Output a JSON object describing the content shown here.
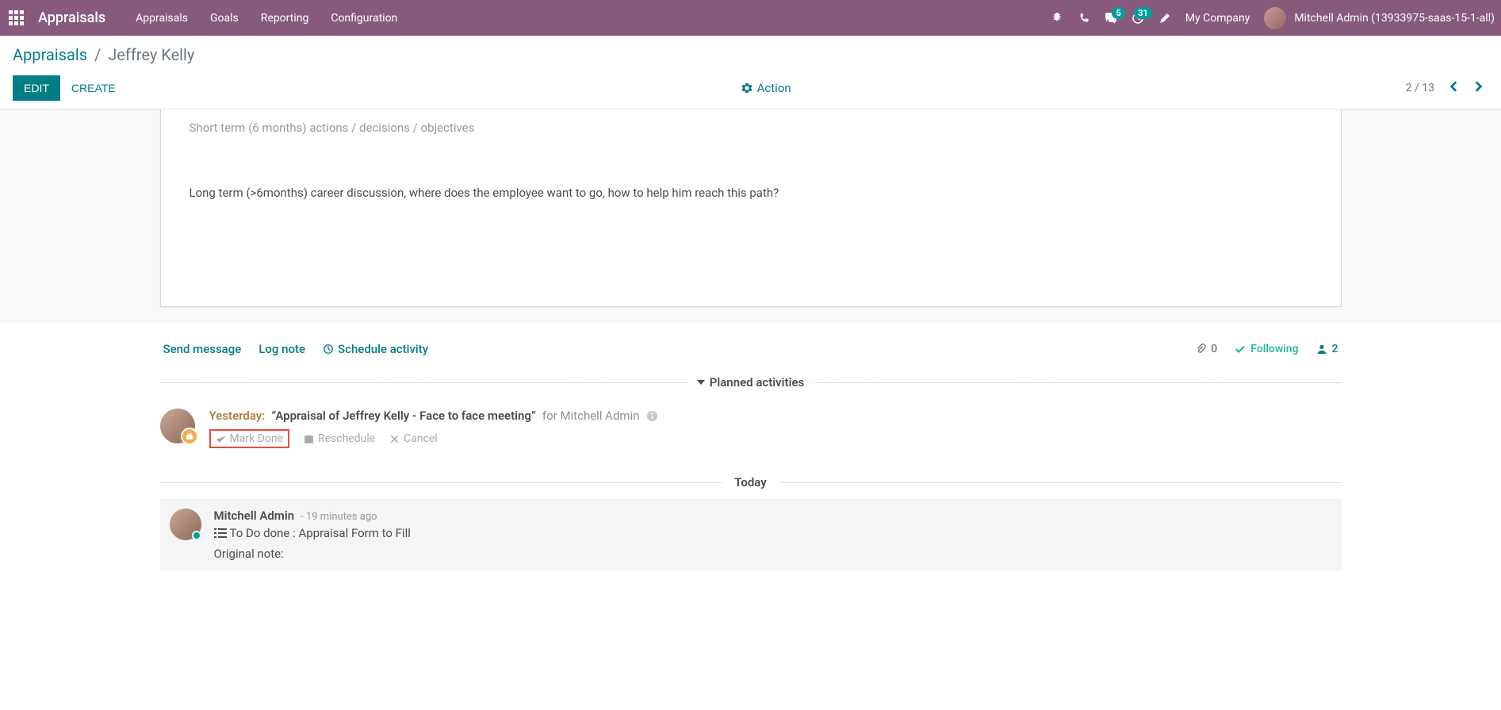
{
  "navbar": {
    "app_name": "Appraisals",
    "menu": [
      "Appraisals",
      "Goals",
      "Reporting",
      "Configuration"
    ],
    "badges": {
      "chat": "5",
      "clock": "31"
    },
    "company": "My Company",
    "user": "Mitchell Admin (13933975-saas-15-1-all)"
  },
  "control": {
    "breadcrumb_root": "Appraisals",
    "breadcrumb_current": "Jeffrey Kelly",
    "edit": "EDIT",
    "create": "CREATE",
    "action": "Action",
    "pager": "2 / 13"
  },
  "form": {
    "line_cut": "Short term (6 months) actions / decisions / objectives",
    "line_full": "Long term (>6months) career discussion, where does the employee want to go, how to help him reach this path?"
  },
  "chatter": {
    "send_message": "Send message",
    "log_note": "Log note",
    "schedule_activity": "Schedule activity",
    "attachments": "0",
    "following": "Following",
    "followers": "2",
    "planned_header": "Planned activities",
    "today_header": "Today"
  },
  "activity": {
    "date": "Yesterday:",
    "title": "“Appraisal of Jeffrey Kelly - Face to face meeting”",
    "for_label": "for Mitchell Admin",
    "mark_done": "Mark Done",
    "reschedule": "Reschedule",
    "cancel": "Cancel"
  },
  "message": {
    "author": "Mitchell Admin",
    "time": "- 19 minutes ago",
    "content": "To Do done : Appraisal Form to Fill",
    "original": "Original note:"
  }
}
